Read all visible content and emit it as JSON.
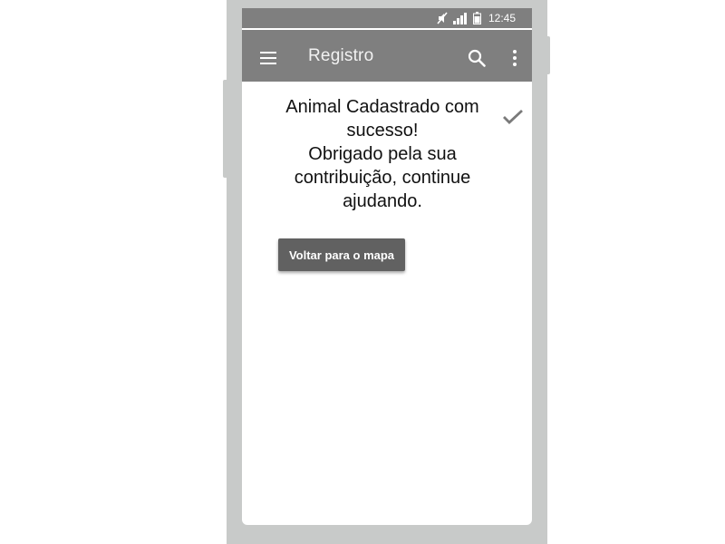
{
  "status_bar": {
    "time": "12:45",
    "icons": [
      "mute-icon",
      "signal-icon",
      "battery-icon"
    ]
  },
  "app_bar": {
    "title": "Registro",
    "icons": [
      "menu-icon",
      "search-icon",
      "more-vert-icon"
    ]
  },
  "content": {
    "message": "Animal Cadastrado com sucesso!\nObrigado pela sua contribuição, continue ajudando.",
    "status_icon": "check-icon",
    "back_button_label": "Voltar para o mapa"
  },
  "colors": {
    "bar": "#7f7f7f",
    "button": "#616161",
    "frame": "#c8cac9"
  }
}
